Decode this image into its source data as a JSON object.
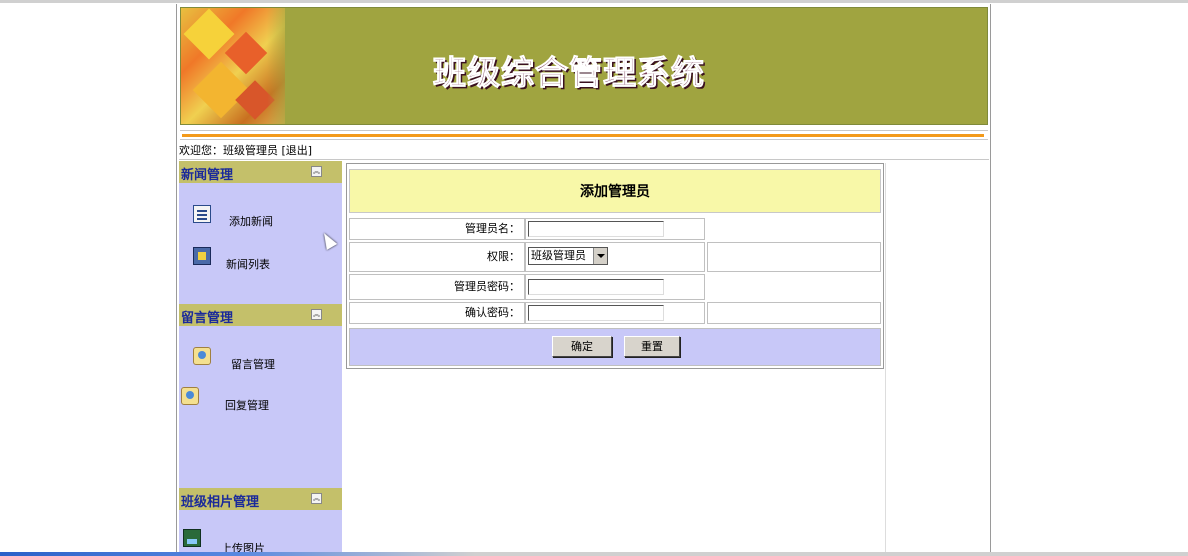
{
  "header": {
    "title": "班级综合管理系统"
  },
  "welcome": {
    "text": "欢迎您：班级管理员",
    "logout": "[退出]"
  },
  "sidebar": {
    "sections": [
      {
        "label": "新闻管理",
        "items": [
          {
            "label": "添加新闻",
            "icon": "document-icon"
          },
          {
            "label": "新闻列表",
            "icon": "list-icon"
          }
        ]
      },
      {
        "label": "留言管理",
        "items": [
          {
            "label": "留言管理",
            "icon": "message-icon"
          },
          {
            "label": "回复管理",
            "icon": "reply-icon"
          }
        ]
      },
      {
        "label": "班级相片管理",
        "items": [
          {
            "label": "上传图片",
            "icon": "picture-icon"
          }
        ]
      }
    ]
  },
  "form": {
    "title": "添加管理员",
    "fields": {
      "username_label": "管理员名：",
      "role_label": "权限：",
      "role_value": "班级管理员",
      "password_label": "管理员密码：",
      "confirm_label": "确认密码："
    },
    "submit_label": "确定",
    "reset_label": "重置"
  },
  "colors": {
    "banner": "#a0a440",
    "sidebar": "#c8c8f8",
    "section_header": "#c4c06a",
    "form_title_bg": "#f8f8a8",
    "accent_bar": "#f39a1a"
  }
}
